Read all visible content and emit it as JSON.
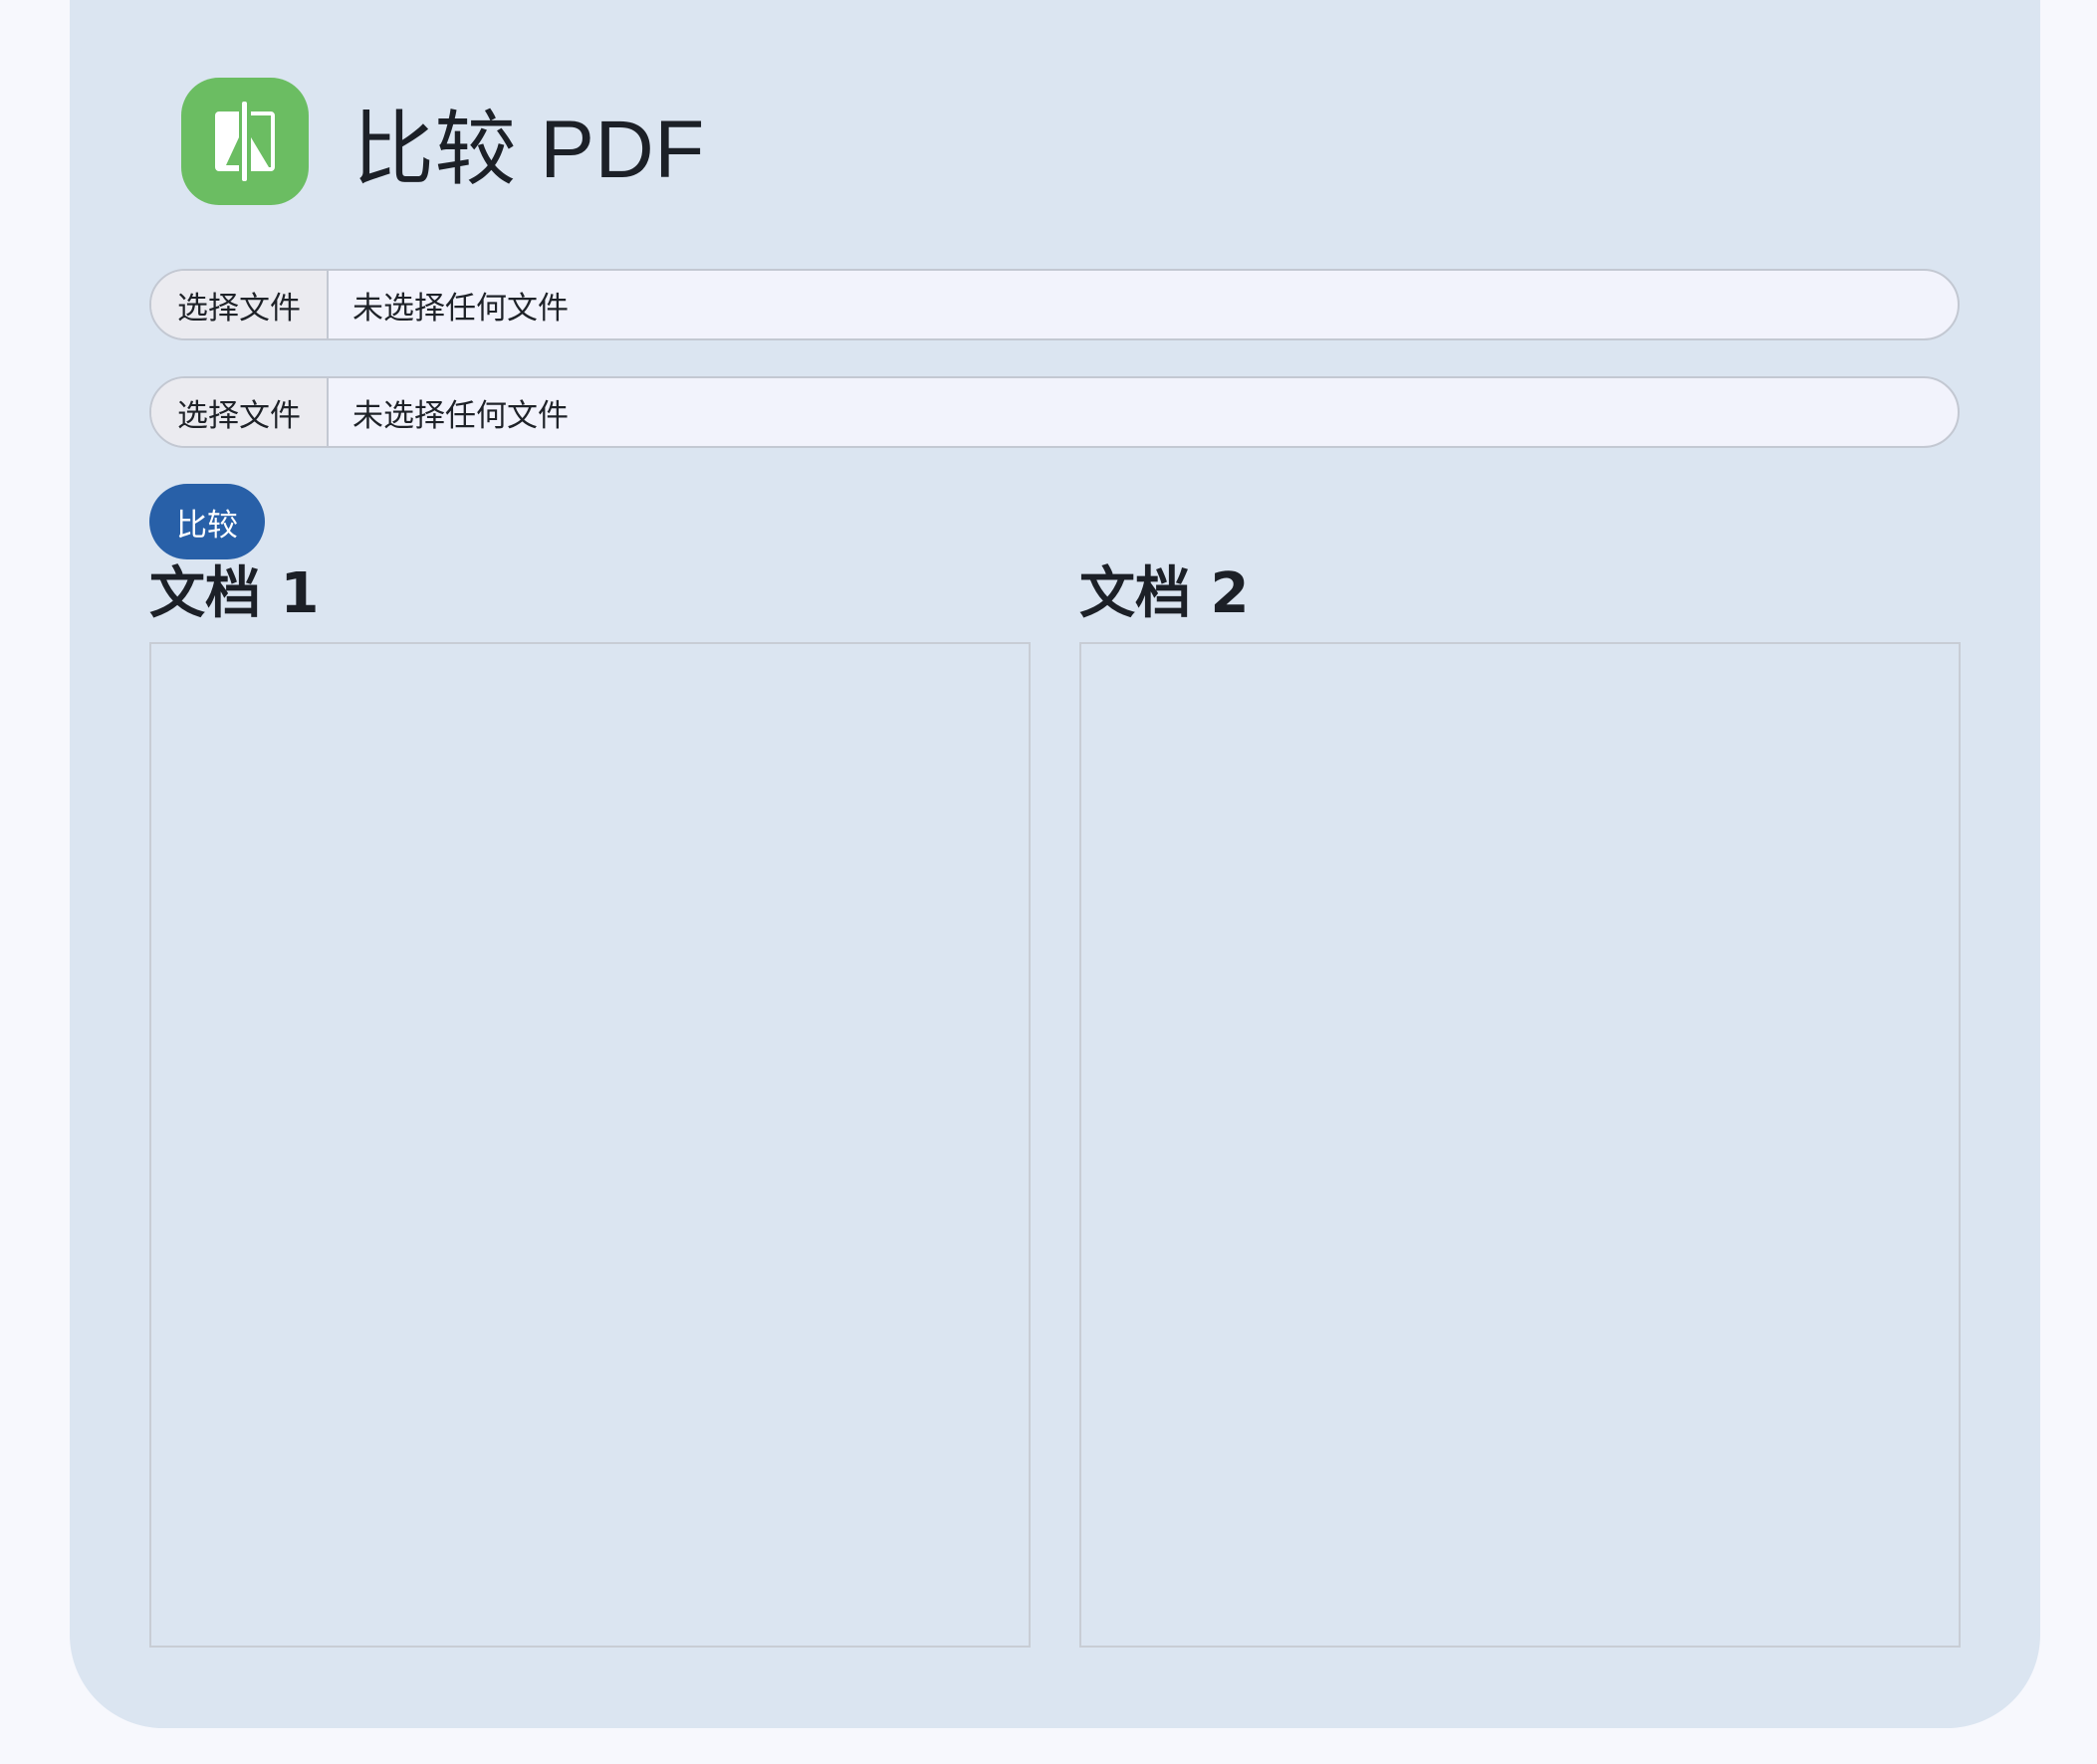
{
  "app": {
    "title": "比较 PDF",
    "icon": "compare-pdf-icon",
    "accent_color": "#6bbd62"
  },
  "inputs": [
    {
      "button_label": "选择文件",
      "status": "未选择任何文件"
    },
    {
      "button_label": "选择文件",
      "status": "未选择任何文件"
    }
  ],
  "actions": {
    "compare_label": "比较",
    "compare_color": "#2860a8"
  },
  "documents": [
    {
      "title": "文档 1"
    },
    {
      "title": "文档 2"
    }
  ]
}
